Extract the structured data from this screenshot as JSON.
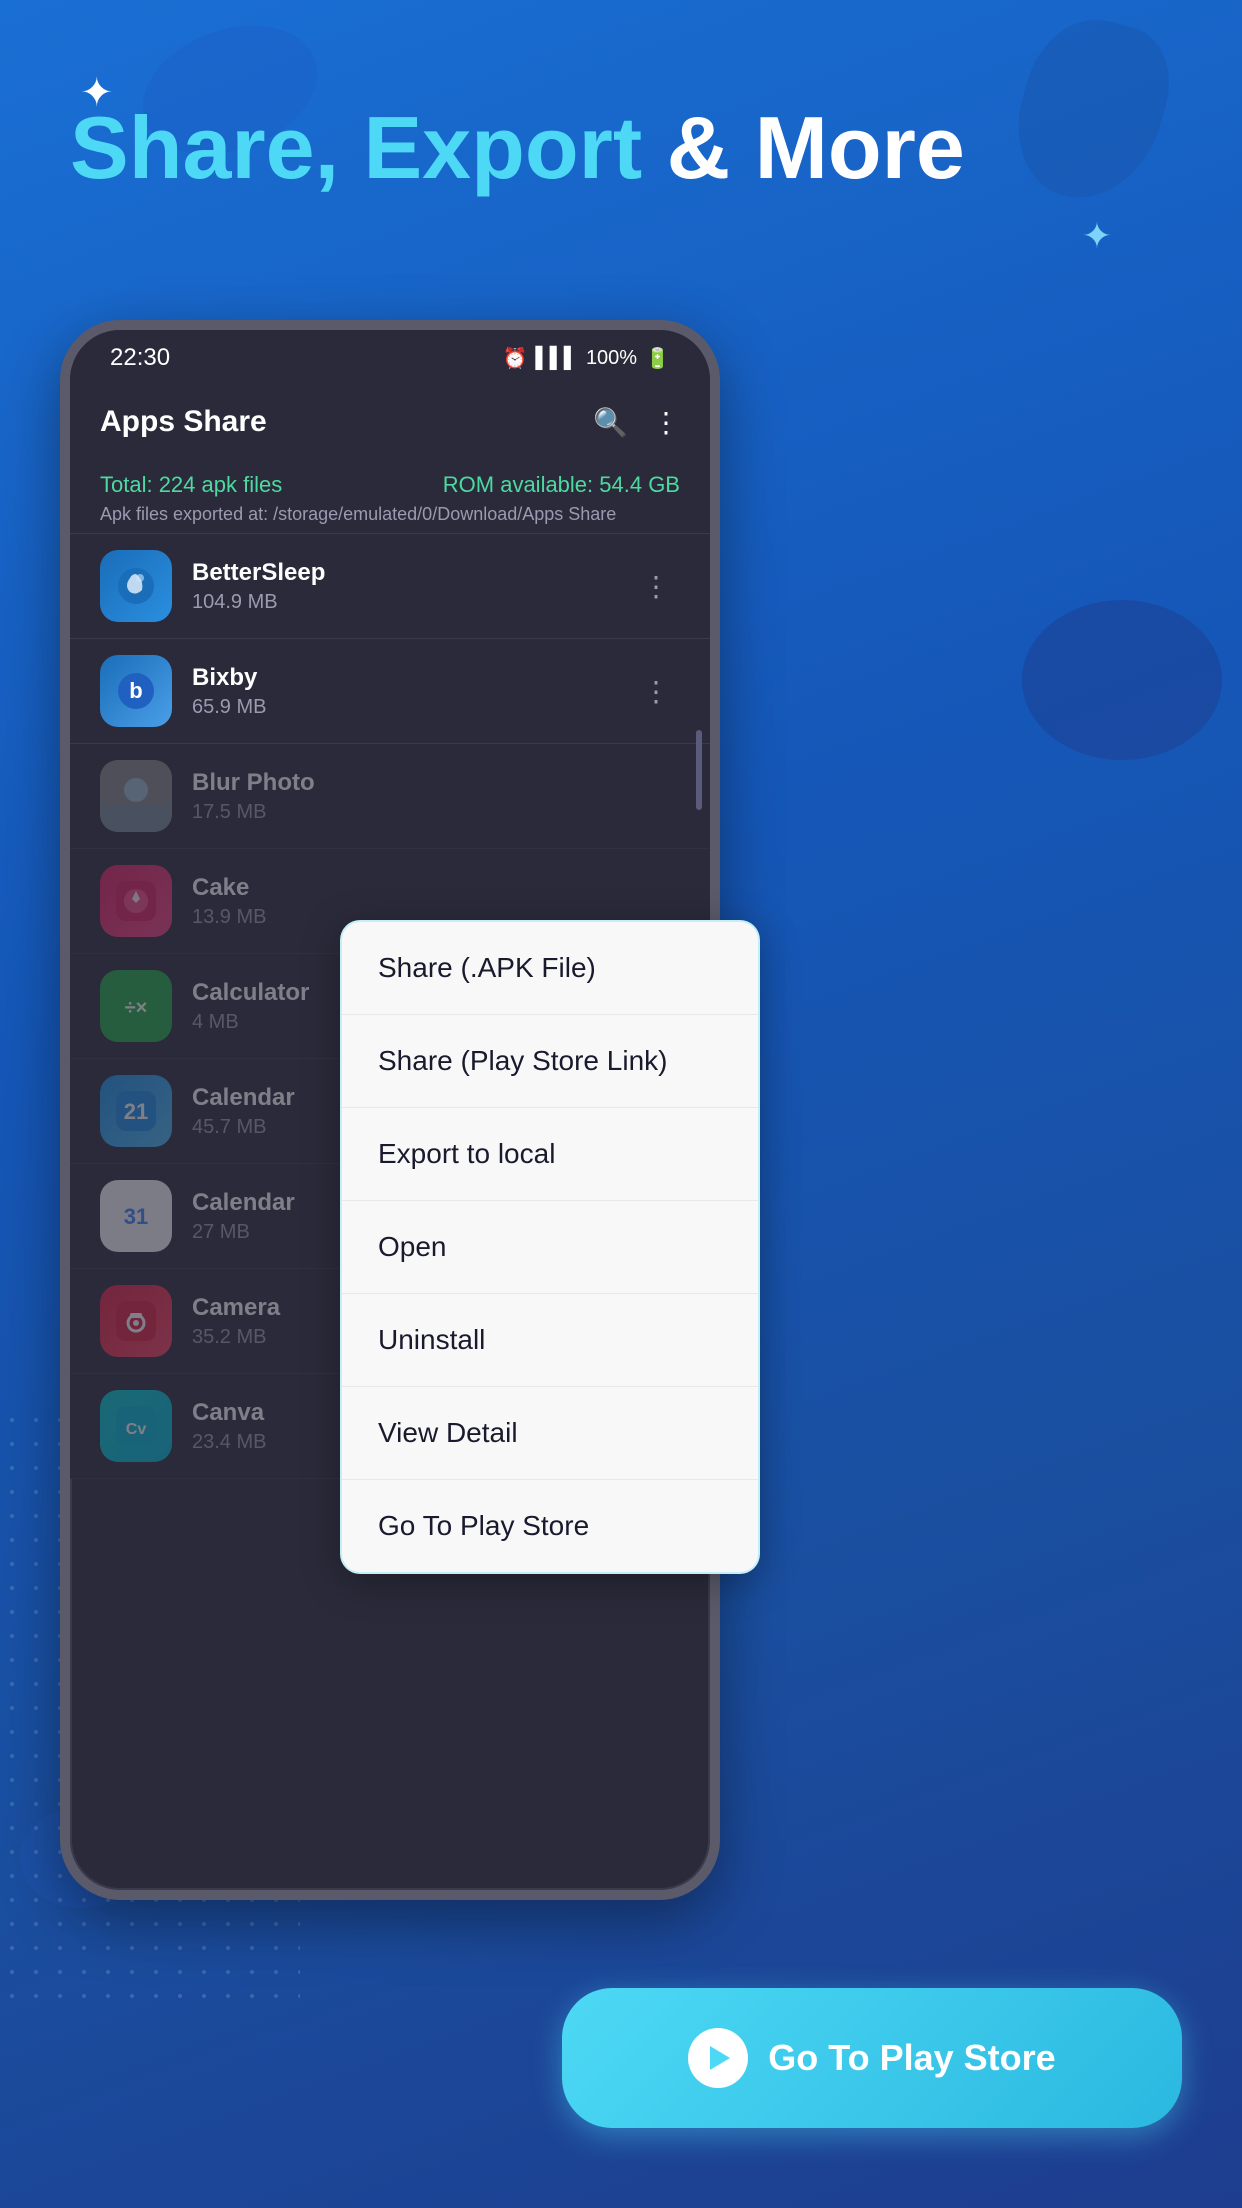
{
  "background": {
    "color_top": "#1a6fd4",
    "color_bottom": "#1e3d8f"
  },
  "header": {
    "sparkle_top": "✦",
    "sparkle_bottom": "✦",
    "title_cyan": "Share, Export",
    "title_white": "& More"
  },
  "status_bar": {
    "time": "22:30",
    "battery": "100%",
    "signal_icon": "📶"
  },
  "app_bar": {
    "title": "Apps Share",
    "search_icon": "🔍",
    "more_icon": "⋮"
  },
  "stats": {
    "total_label": "Total: 224 apk files",
    "rom_label": "ROM available: 54.4 GB",
    "path_label": "Apk files exported at: /storage/emulated/0/Download/Apps Share"
  },
  "app_list": [
    {
      "name": "BetterSleep",
      "size": "104.9 MB",
      "icon_type": "bettersleep"
    },
    {
      "name": "Bixby",
      "size": "65.9 MB",
      "icon_type": "bixby"
    },
    {
      "name": "Blur Photo",
      "size": "17.5 MB",
      "icon_type": "blur"
    },
    {
      "name": "Cake",
      "size": "13.9 MB",
      "icon_type": "cake"
    },
    {
      "name": "Calculator",
      "size": "4 MB",
      "icon_type": "calculator"
    },
    {
      "name": "Calendar",
      "size": "45.7 MB",
      "icon_type": "calendar1"
    },
    {
      "name": "Calendar",
      "size": "27 MB",
      "icon_type": "calendar2"
    },
    {
      "name": "Camera",
      "size": "35.2 MB",
      "icon_type": "camera"
    },
    {
      "name": "Canva",
      "size": "23.4 MB",
      "icon_type": "canva"
    }
  ],
  "context_menu": {
    "items": [
      "Share (.APK File)",
      "Share (Play Store Link)",
      "Export to local",
      "Open",
      "Uninstall",
      "View Detail",
      "Go To Play Store"
    ]
  },
  "cta": {
    "label": "Go To Play Store"
  }
}
